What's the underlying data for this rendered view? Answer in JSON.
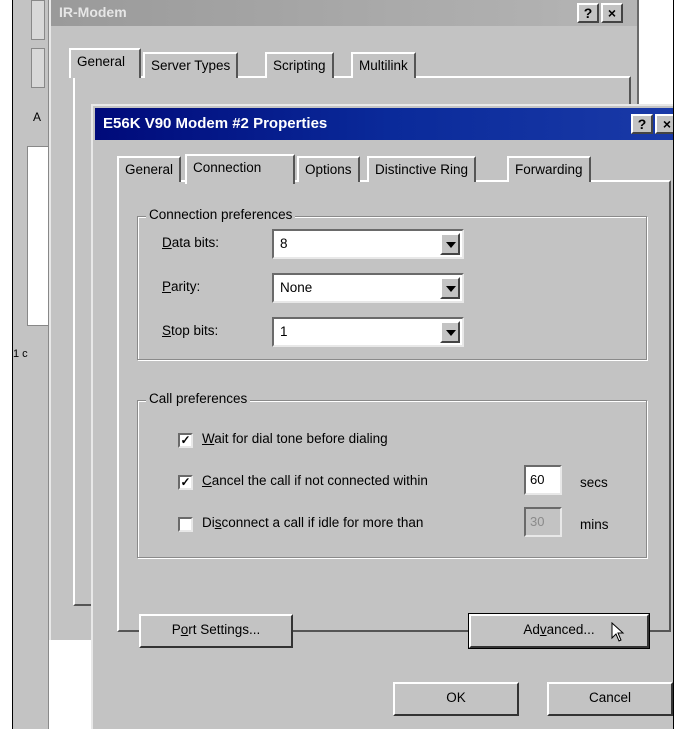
{
  "background_window": {
    "title": "IR-Modem",
    "help_button": "?",
    "close_button": "×",
    "tabs": [
      "General",
      "Server Types",
      "Scripting",
      "Multilink"
    ],
    "left_glyph_1": "A",
    "left_glyph_2": "1 c"
  },
  "dialog": {
    "title": "E56K V90 Modem #2 Properties",
    "help_button": "?",
    "close_button": "×",
    "tabs": [
      "General",
      "Connection",
      "Options",
      "Distinctive Ring",
      "Forwarding"
    ],
    "active_tab": "Connection"
  },
  "connection_preferences": {
    "label": "Connection preferences",
    "data_bits": {
      "label_accel": "D",
      "label_rest": "ata bits:",
      "value": "8"
    },
    "parity": {
      "label_accel": "P",
      "label_rest": "arity:",
      "value": "None"
    },
    "stop_bits": {
      "label_accel": "S",
      "label_rest": "top bits:",
      "value": "1"
    }
  },
  "call_preferences": {
    "label": "Call preferences",
    "wait_dial_tone": {
      "accel": "W",
      "rest": "ait for dial tone before dialing",
      "checked": true
    },
    "cancel_call": {
      "accel": "C",
      "rest": "ancel the call if not connected within",
      "checked": true,
      "value": "60",
      "unit": "secs"
    },
    "disconnect_idle": {
      "pre": "Di",
      "accel": "s",
      "rest": "connect a call if idle for more than",
      "checked": false,
      "value": "30",
      "unit": "mins"
    }
  },
  "buttons": {
    "port_settings_pre": "P",
    "port_settings_accel": "o",
    "port_settings_rest": "rt Settings...",
    "advanced_pre": "Ad",
    "advanced_accel": "v",
    "advanced_rest": "anced...",
    "ok": "OK",
    "cancel": "Cancel"
  },
  "colors": {
    "title_bar": "#0a2a9a",
    "face": "#c3c3c3"
  }
}
